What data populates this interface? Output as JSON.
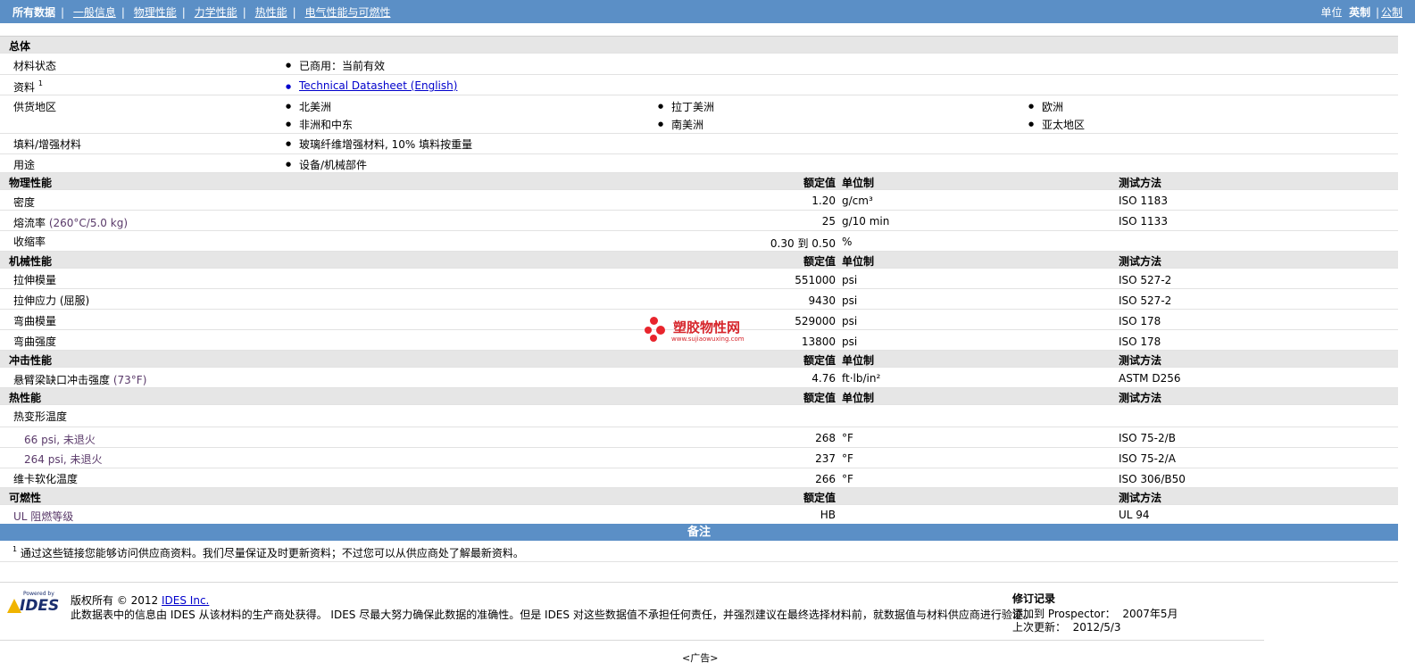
{
  "nav": {
    "items": [
      "所有数据",
      "一般信息",
      "物理性能",
      "力学性能",
      "热性能",
      "电气性能与可燃性"
    ],
    "unit_label": "单位",
    "unit_english": "英制",
    "unit_metric": "公制"
  },
  "general": {
    "header": "总体",
    "status_label": "材料状态",
    "status_value": "已商用：当前有效",
    "literature_label": "资料",
    "literature_sup": "1",
    "literature_value": "Technical Datasheet (English)",
    "regions_label": "供货地区",
    "regions": [
      "北美洲",
      "拉丁美洲",
      "欧洲",
      "非洲和中东",
      "南美洲",
      "亚太地区"
    ],
    "filler_label": "填料/增强材料",
    "filler_value": "玻璃纤维增强材料, 10% 填料按重量",
    "uses_label": "用途",
    "uses_value": "设备/机械部件"
  },
  "cols": {
    "nominal": "额定值",
    "unit": "单位制",
    "method": "测试方法"
  },
  "physical": {
    "header": "物理性能",
    "rows": [
      {
        "name": "密度",
        "cond": "",
        "value": "1.20",
        "unit": "g/cm³",
        "method": "ISO 1183"
      },
      {
        "name": "熔流率",
        "cond": "(260°C/5.0 kg)",
        "value": "25",
        "unit": "g/10 min",
        "method": "ISO 1133"
      },
      {
        "name": "收缩率",
        "cond": "",
        "value": "0.30 到  0.50",
        "unit": "%",
        "method": ""
      }
    ]
  },
  "mechanical": {
    "header": "机械性能",
    "rows": [
      {
        "name": "拉伸模量",
        "value": "551000",
        "unit": "psi",
        "method": "ISO 527-2"
      },
      {
        "name": "拉伸应力 (屈服)",
        "value": "9430",
        "unit": "psi",
        "method": "ISO 527-2"
      },
      {
        "name": "弯曲模量",
        "value": "529000",
        "unit": "psi",
        "method": "ISO 178"
      },
      {
        "name": "弯曲强度",
        "value": "13800",
        "unit": "psi",
        "method": "ISO 178"
      }
    ]
  },
  "impact": {
    "header": "冲击性能",
    "rows": [
      {
        "name": "悬臂梁缺口冲击强度",
        "cond": "(73°F)",
        "value": "4.76",
        "unit": "ft·lb/in²",
        "method": "ASTM D256"
      }
    ]
  },
  "thermal": {
    "header": "热性能",
    "hdt_label": "热变形温度",
    "rows": [
      {
        "name": "66 psi, 未退火",
        "value": "268",
        "unit": "°F",
        "method": "ISO 75-2/B"
      },
      {
        "name": "264 psi, 未退火",
        "value": "237",
        "unit": "°F",
        "method": "ISO 75-2/A"
      },
      {
        "name": "维卡软化温度",
        "value": "266",
        "unit": "°F",
        "method": "ISO 306/B50"
      }
    ]
  },
  "flammability": {
    "header": "可燃性",
    "rows": [
      {
        "name": "UL 阻燃等级",
        "value": "HB",
        "unit": "",
        "method": "UL 94"
      }
    ]
  },
  "notes": {
    "header": "备注",
    "sup": "1",
    "text": "通过这些链接您能够访问供应商资料。我们尽量保证及时更新资料；不过您可以从供应商处了解最新资料。"
  },
  "watermark": {
    "title": "塑胶物性网",
    "url": "www.sujiaowuxing.com"
  },
  "footer": {
    "logo_powered": "Powered by",
    "logo_name": "IDES",
    "copyright": "版权所有 © 2012",
    "company": "IDES Inc.",
    "disclaimer": "此数据表中的信息由  IDES 从该材料的生产商处获得。 IDES 尽最大努力确保此数据的准确性。但是  IDES 对这些数据值不承担任何责任，并强烈建议在最终选择材料前，就数据值与材料供应商进行验证。",
    "rev_title": "修订记录",
    "added_label": "添加到  Prospector：",
    "added_value": "2007年5月",
    "updated_label": "上次更新：",
    "updated_value": "2012/5/3",
    "ad": "<广告>"
  }
}
